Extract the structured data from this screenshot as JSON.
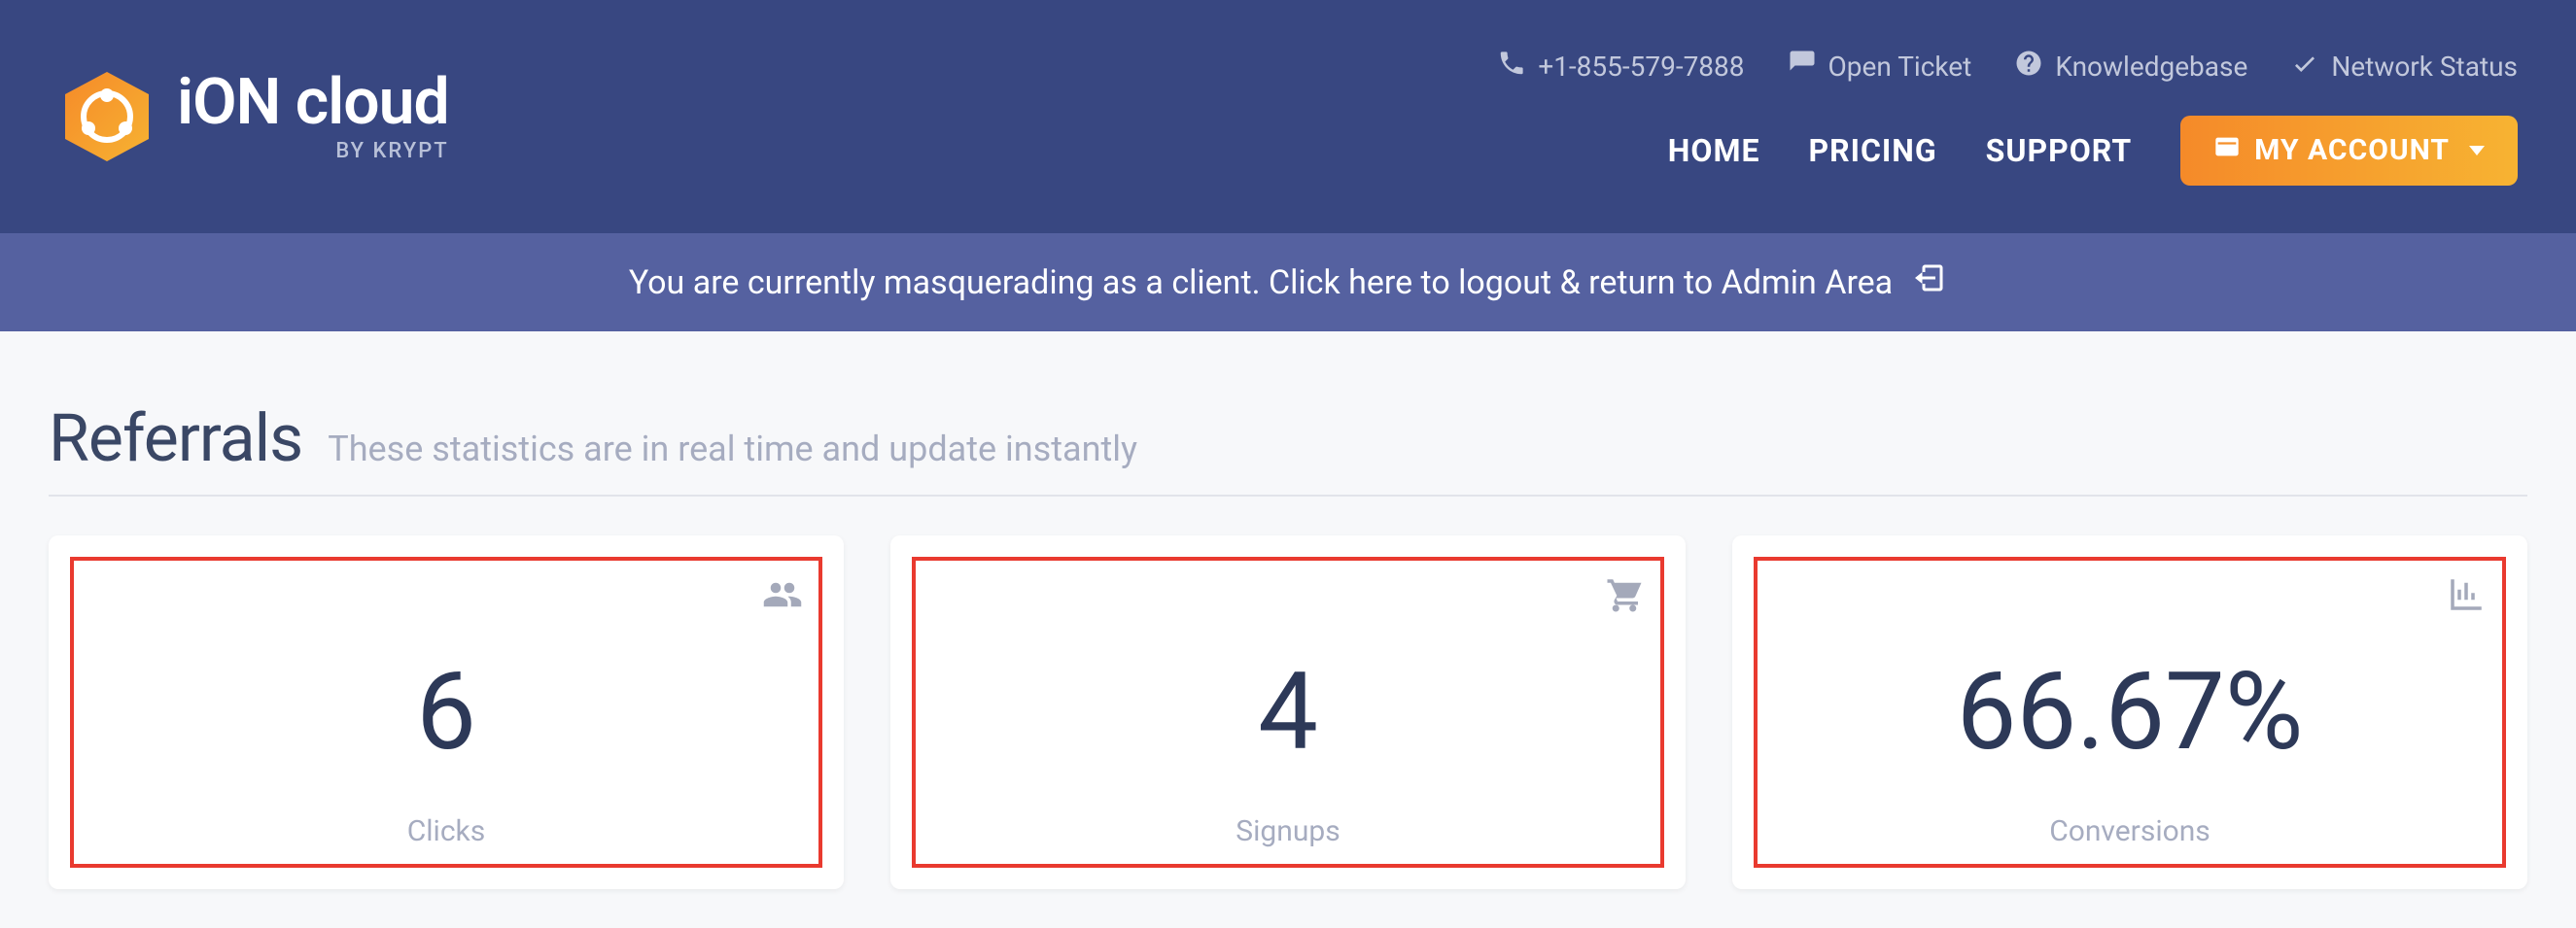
{
  "brand": {
    "title": "iON cloud",
    "subtitle": "BY KRYPT"
  },
  "top_links": {
    "phone": "+1-855-579-7888",
    "ticket": "Open Ticket",
    "kb": "Knowledgebase",
    "status": "Network Status"
  },
  "nav": {
    "home": "HOME",
    "pricing": "PRICING",
    "support": "SUPPORT",
    "account": "MY ACCOUNT"
  },
  "masquerade_banner": "You are currently masquerading as a client. Click here to logout & return to Admin Area",
  "page": {
    "title": "Referrals",
    "subtitle": "These statistics are in real time and update instantly"
  },
  "stats": {
    "clicks": {
      "value": "6",
      "label": "Clicks"
    },
    "signups": {
      "value": "4",
      "label": "Signups"
    },
    "conversions": {
      "value": "66.67%",
      "label": "Conversions"
    }
  }
}
